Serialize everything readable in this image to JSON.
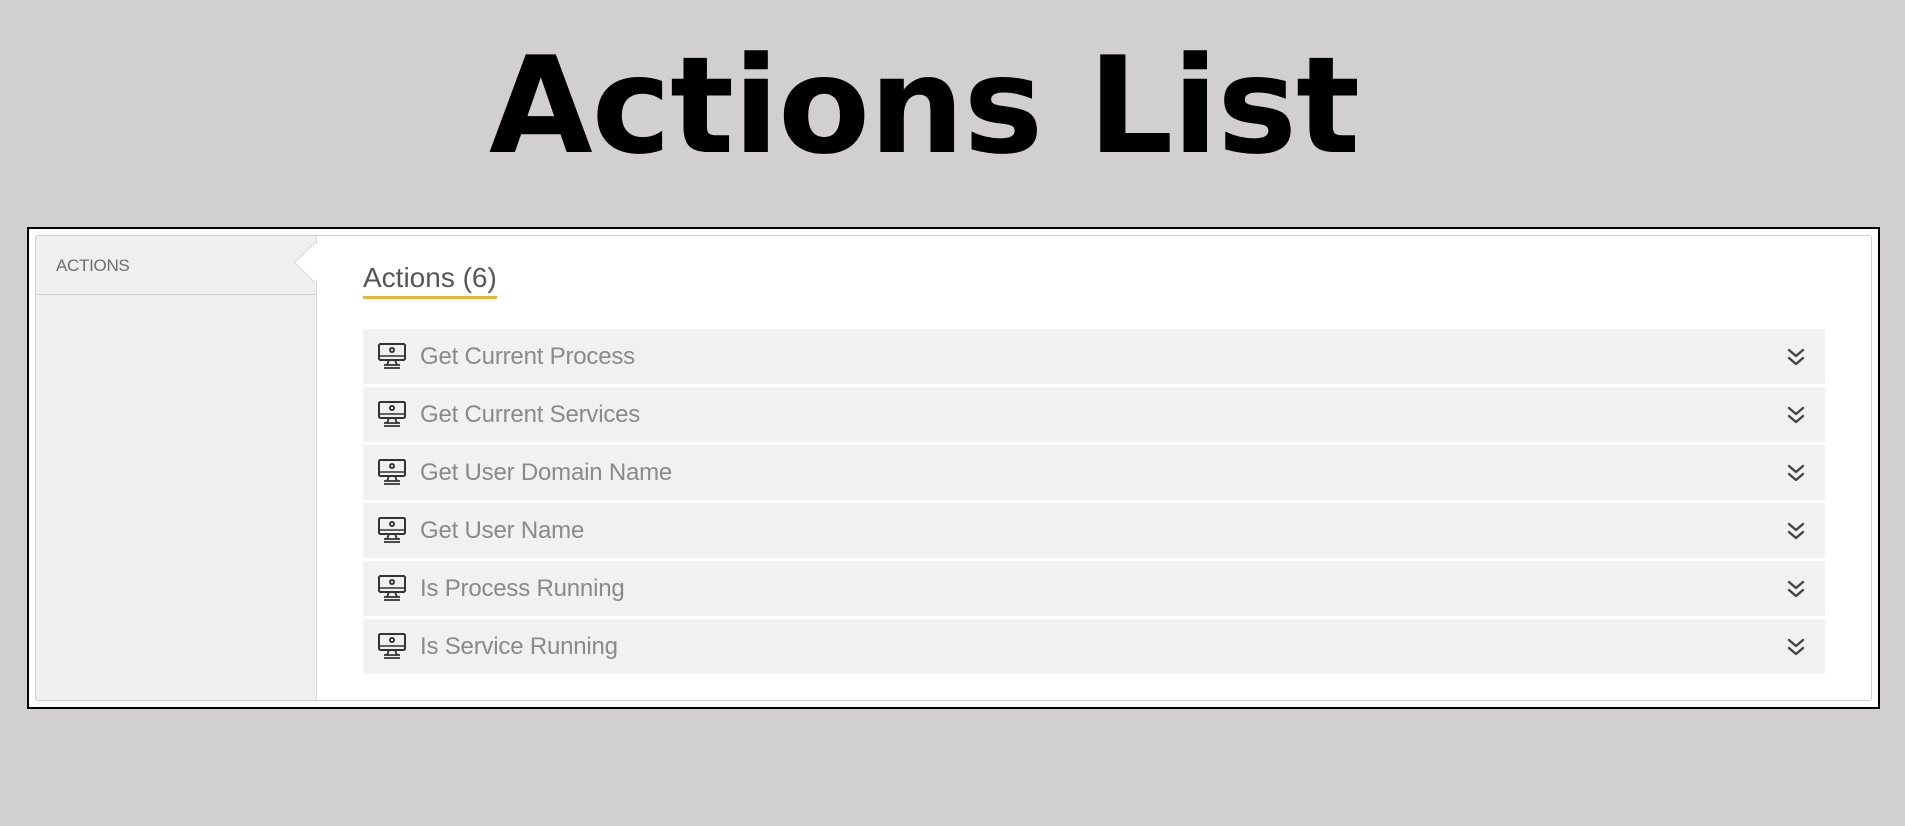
{
  "page": {
    "title": "Actions List"
  },
  "sidebar": {
    "tab_label": "ACTIONS"
  },
  "main": {
    "header": "Actions (6)",
    "actions": [
      {
        "label": "Get Current Process",
        "icon": "monitor-gear-icon",
        "toggle_icon": "chevron-double-down-icon"
      },
      {
        "label": "Get Current Services",
        "icon": "monitor-gear-icon",
        "toggle_icon": "chevron-double-down-icon"
      },
      {
        "label": "Get User Domain Name",
        "icon": "monitor-gear-icon",
        "toggle_icon": "chevron-double-down-icon"
      },
      {
        "label": "Get User Name",
        "icon": "monitor-gear-icon",
        "toggle_icon": "chevron-double-down-icon"
      },
      {
        "label": "Is Process Running",
        "icon": "monitor-gear-icon",
        "toggle_icon": "chevron-double-down-icon"
      },
      {
        "label": "Is Service Running",
        "icon": "monitor-gear-icon",
        "toggle_icon": "chevron-double-down-icon"
      }
    ]
  },
  "colors": {
    "background": "#d1cfd0",
    "header_underline": "#f0b51b",
    "row_background": "#f1f1f1",
    "sidebar_background": "#efefef"
  }
}
